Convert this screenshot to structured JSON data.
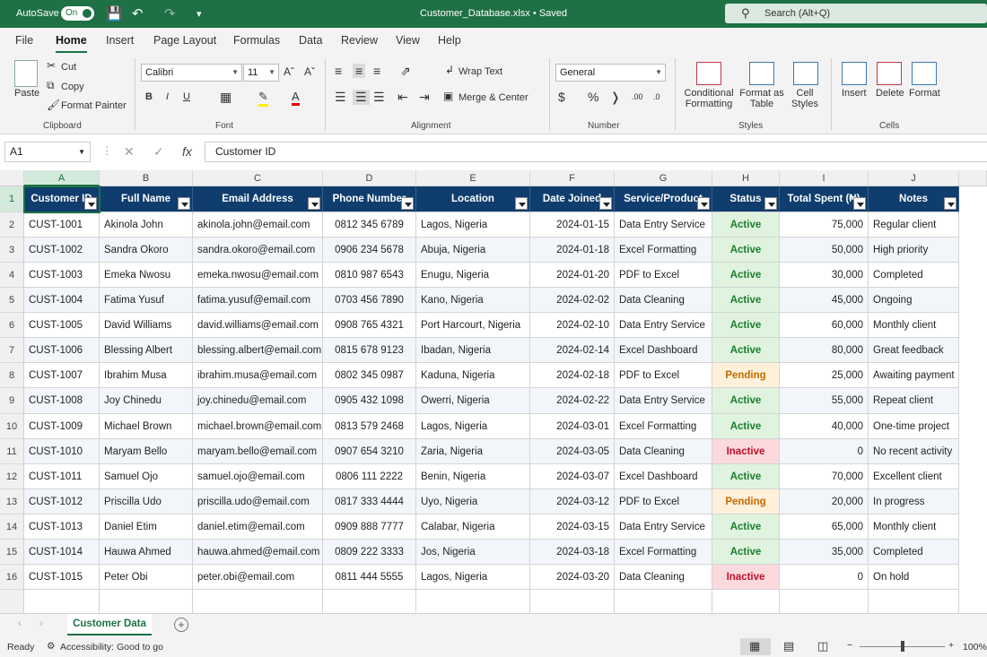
{
  "titlebar": {
    "autosave_label": "AutoSave",
    "autosave_state": "On",
    "doc_title": "Customer_Database.xlsx • Saved",
    "search_placeholder": "Search (Alt+Q)"
  },
  "menu": [
    "File",
    "Home",
    "Insert",
    "Page Layout",
    "Formulas",
    "Data",
    "Review",
    "View",
    "Help"
  ],
  "ribbon": {
    "paste": "Paste",
    "cut": "Cut",
    "copy": "Copy",
    "format_painter": "Format Painter",
    "clipboard": "Clipboard",
    "font_name": "Calibri",
    "font_size": "11",
    "font_group": "Font",
    "wrap_text": "Wrap Text",
    "merge_center": "Merge & Center",
    "alignment": "Alignment",
    "number_format": "General",
    "number_group": "Number",
    "conditional_formatting": [
      "Conditional",
      "Formatting"
    ],
    "format_as_table": [
      "Format as",
      "Table"
    ],
    "cell_styles": [
      "Cell",
      "Styles"
    ],
    "styles": "Styles",
    "insert": "Insert",
    "delete": "Delete",
    "format": "Format",
    "cells": "Cells"
  },
  "formula_bar": {
    "name_box": "A1",
    "fx": "fx",
    "content": "Customer ID"
  },
  "columns": [
    "A",
    "B",
    "C",
    "D",
    "E",
    "F",
    "G",
    "H",
    "I",
    "J"
  ],
  "headers": [
    "Customer ID",
    "Full Name",
    "Email Address",
    "Phone Number",
    "Location",
    "Date Joined",
    "Service/Product",
    "Status",
    "Total Spent (₦)",
    "Notes"
  ],
  "rows": [
    [
      "CUST-1001",
      "Akinola John",
      "akinola.john@email.com",
      "0812 345 6789",
      "Lagos, Nigeria",
      "2024-01-15",
      "Data Entry Service",
      "Active",
      "75,000",
      "Regular client"
    ],
    [
      "CUST-1002",
      "Sandra Okoro",
      "sandra.okoro@email.com",
      "0906 234 5678",
      "Abuja, Nigeria",
      "2024-01-18",
      "Excel Formatting",
      "Active",
      "50,000",
      "High priority"
    ],
    [
      "CUST-1003",
      "Emeka Nwosu",
      "emeka.nwosu@email.com",
      "0810 987 6543",
      "Enugu, Nigeria",
      "2024-01-20",
      "PDF to Excel",
      "Active",
      "30,000",
      "Completed"
    ],
    [
      "CUST-1004",
      "Fatima Yusuf",
      "fatima.yusuf@email.com",
      "0703 456 7890",
      "Kano, Nigeria",
      "2024-02-02",
      "Data Cleaning",
      "Active",
      "45,000",
      "Ongoing"
    ],
    [
      "CUST-1005",
      "David Williams",
      "david.williams@email.com",
      "0908 765 4321",
      "Port Harcourt, Nigeria",
      "2024-02-10",
      "Data Entry Service",
      "Active",
      "60,000",
      "Monthly client"
    ],
    [
      "CUST-1006",
      "Blessing Albert",
      "blessing.albert@email.com",
      "0815 678 9123",
      "Ibadan, Nigeria",
      "2024-02-14",
      "Excel Dashboard",
      "Active",
      "80,000",
      "Great feedback"
    ],
    [
      "CUST-1007",
      "Ibrahim Musa",
      "ibrahim.musa@email.com",
      "0802 345 0987",
      "Kaduna, Nigeria",
      "2024-02-18",
      "PDF to Excel",
      "Pending",
      "25,000",
      "Awaiting payment"
    ],
    [
      "CUST-1008",
      "Joy Chinedu",
      "joy.chinedu@email.com",
      "0905 432 1098",
      "Owerri, Nigeria",
      "2024-02-22",
      "Data Entry Service",
      "Active",
      "55,000",
      "Repeat client"
    ],
    [
      "CUST-1009",
      "Michael Brown",
      "michael.brown@email.com",
      "0813 579 2468",
      "Lagos, Nigeria",
      "2024-03-01",
      "Excel Formatting",
      "Active",
      "40,000",
      "One-time project"
    ],
    [
      "CUST-1010",
      "Maryam Bello",
      "maryam.bello@email.com",
      "0907 654 3210",
      "Zaria, Nigeria",
      "2024-03-05",
      "Data Cleaning",
      "Inactive",
      "0",
      "No recent activity"
    ],
    [
      "CUST-1011",
      "Samuel Ojo",
      "samuel.ojo@email.com",
      "0806 111 2222",
      "Benin, Nigeria",
      "2024-03-07",
      "Excel Dashboard",
      "Active",
      "70,000",
      "Excellent client"
    ],
    [
      "CUST-1012",
      "Priscilla Udo",
      "priscilla.udo@email.com",
      "0817 333 4444",
      "Uyo, Nigeria",
      "2024-03-12",
      "PDF to Excel",
      "Pending",
      "20,000",
      "In progress"
    ],
    [
      "CUST-1013",
      "Daniel Etim",
      "daniel.etim@email.com",
      "0909 888 7777",
      "Calabar, Nigeria",
      "2024-03-15",
      "Data Entry Service",
      "Active",
      "65,000",
      "Monthly client"
    ],
    [
      "CUST-1014",
      "Hauwa Ahmed",
      "hauwa.ahmed@email.com",
      "0809 222 3333",
      "Jos, Nigeria",
      "2024-03-18",
      "Excel Formatting",
      "Active",
      "35,000",
      "Completed"
    ],
    [
      "CUST-1015",
      "Peter Obi",
      "peter.obi@email.com",
      "0811 444 5555",
      "Lagos, Nigeria",
      "2024-03-20",
      "Data Cleaning",
      "Inactive",
      "0",
      "On hold"
    ]
  ],
  "sheet_tab": "Customer Data",
  "status": {
    "ready": "Ready",
    "accessibility": "Accessibility: Good to go",
    "zoom": "100%"
  }
}
